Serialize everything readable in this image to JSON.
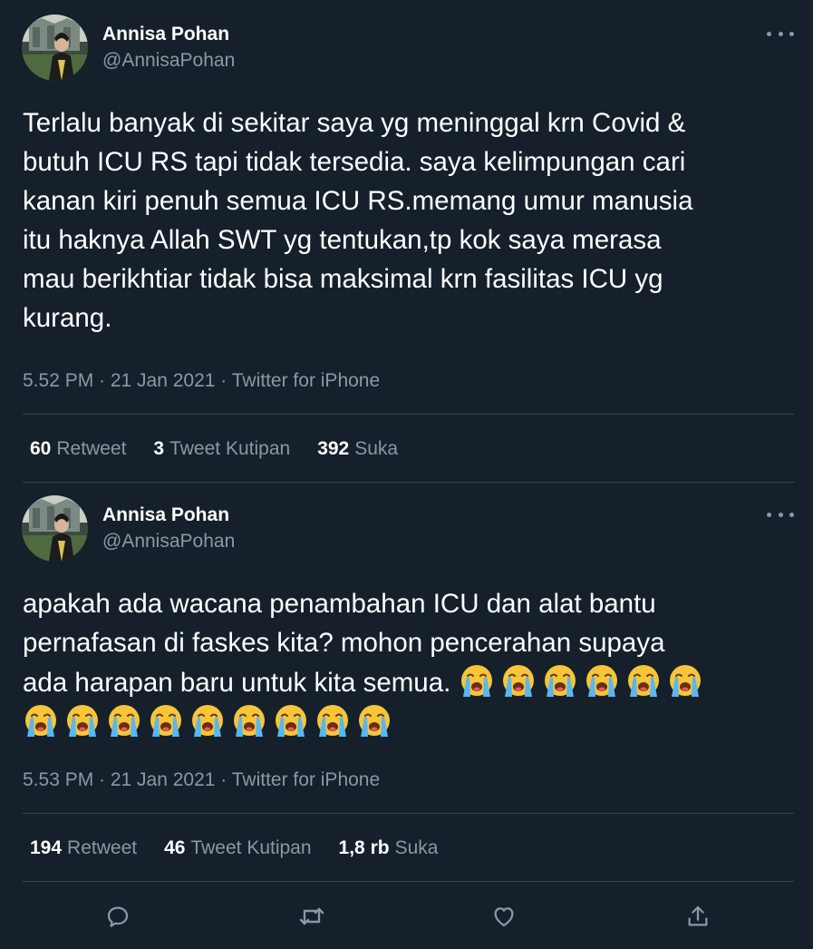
{
  "tweets": [
    {
      "author_name": "Annisa Pohan",
      "author_handle": "@AnnisaPohan",
      "text": "Terlalu banyak di sekitar saya yg meninggal krn Covid &\nbutuh ICU RS tapi tidak tersedia. saya kelimpungan cari\nkanan kiri penuh semua ICU RS.memang umur manusia\nitu haknya Allah SWT yg tentukan,tp kok saya merasa\nmau berikhtiar tidak bisa maksimal krn fasilitas ICU yg\nkurang.",
      "meta": "5.52 PM · 21 Jan 2021 · Twitter for iPhone",
      "retweet_count": "60",
      "retweet_label": "Retweet",
      "quote_count": "3",
      "quote_label": "Tweet Kutipan",
      "like_count": "392",
      "like_label": "Suka"
    },
    {
      "author_name": "Annisa Pohan",
      "author_handle": "@AnnisaPohan",
      "text": "apakah ada wacana penambahan ICU dan alat bantu\npernafasan di faskes kita? mohon pencerahan supaya\nada harapan baru untuk kita semua. ",
      "emoji": "loudly-crying-face",
      "emoji_count_line1": 6,
      "emoji_count_line2": 9,
      "meta": "5.53 PM · 21 Jan 2021 · Twitter for iPhone",
      "retweet_count": "194",
      "retweet_label": "Retweet",
      "quote_count": "46",
      "quote_label": "Tweet Kutipan",
      "like_count": "1,8 rb",
      "like_label": "Suka"
    }
  ],
  "actions": [
    "reply-icon",
    "retweet-icon",
    "like-icon",
    "share-icon"
  ],
  "colors": {
    "background": "#15202b",
    "secondary_text": "#8899a6",
    "divider": "#38444d"
  }
}
